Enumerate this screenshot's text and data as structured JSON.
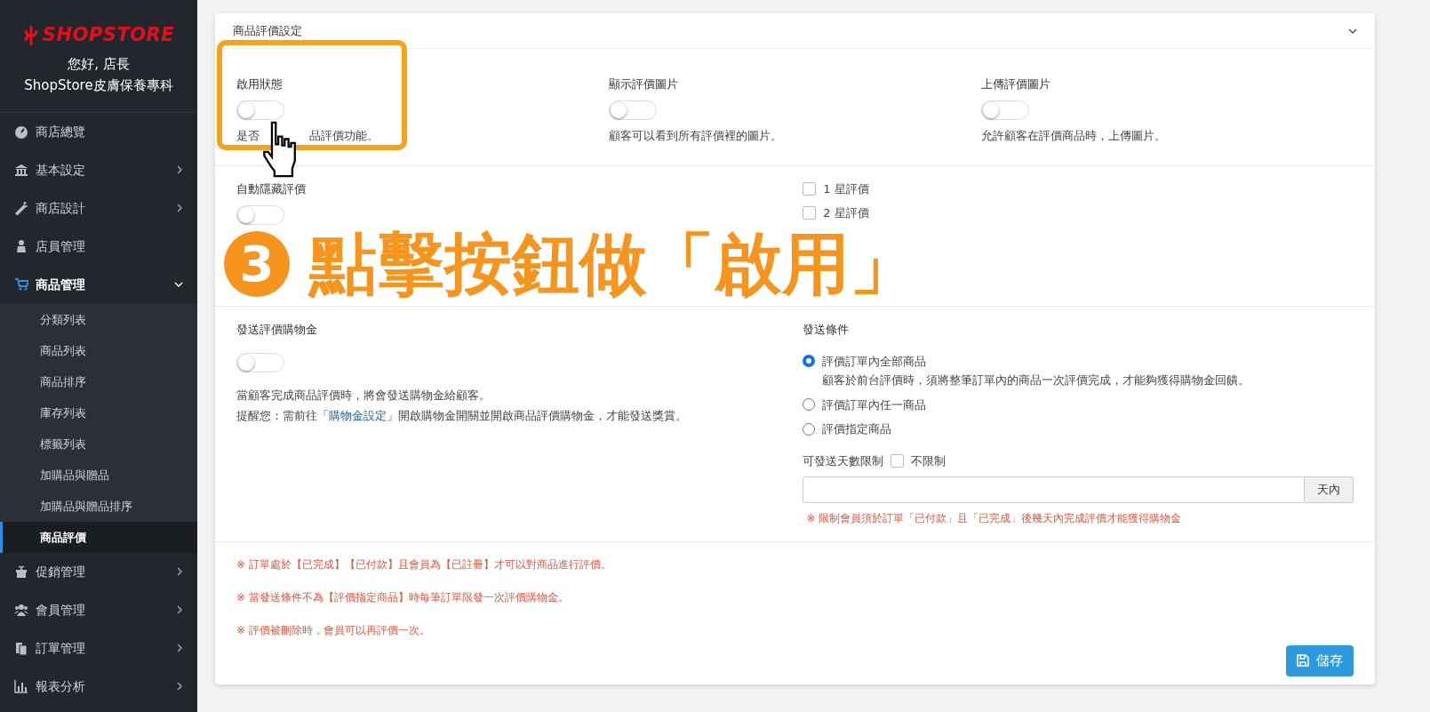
{
  "sidebar": {
    "logo": "SHOPSTORE",
    "greeting": "您好, 店長",
    "store_name": "ShopStore皮膚保養專科",
    "items": [
      {
        "label": "商店總覽",
        "kind": "link",
        "expanded": false
      },
      {
        "label": "基本設定",
        "kind": "menu",
        "expanded": false
      },
      {
        "label": "商店設計",
        "kind": "menu",
        "expanded": false
      },
      {
        "label": "店員管理",
        "kind": "link",
        "expanded": false
      },
      {
        "label": "商品管理",
        "kind": "menu",
        "expanded": true,
        "children": [
          {
            "label": "分類列表",
            "selected": false
          },
          {
            "label": "商品列表",
            "selected": false
          },
          {
            "label": "商品排序",
            "selected": false
          },
          {
            "label": "庫存列表",
            "selected": false
          },
          {
            "label": "標籤列表",
            "selected": false
          },
          {
            "label": "加購品與贈品",
            "selected": false
          },
          {
            "label": "加購品與贈品排序",
            "selected": false
          },
          {
            "label": "商品評價",
            "selected": true
          }
        ]
      },
      {
        "label": "促銷管理",
        "kind": "menu",
        "expanded": false
      },
      {
        "label": "會員管理",
        "kind": "menu",
        "expanded": false
      },
      {
        "label": "訂單管理",
        "kind": "menu",
        "expanded": false
      },
      {
        "label": "報表分析",
        "kind": "menu",
        "expanded": false
      }
    ]
  },
  "panel": {
    "title": "商品評價設定",
    "toggles": [
      {
        "label": "啟用狀態",
        "on": false,
        "description_parts": [
          "是否",
          "品評價功能。"
        ]
      },
      {
        "label": "顯示評價圖片",
        "on": false,
        "description": "顧客可以看到所有評價裡的圖片。"
      },
      {
        "label": "上傳評價圖片",
        "on": false,
        "description": "允許顧客在評價商品時，上傳圖片。"
      }
    ],
    "auto_hide": {
      "label": "自動隱藏評價",
      "on": false,
      "stars": [
        {
          "label": "1 星評價",
          "checked": false
        },
        {
          "label": "2 星評價",
          "checked": false
        }
      ]
    },
    "reward": {
      "label": "發送評價購物金",
      "on": false,
      "description": "當顧客完成商品評價時，將會發送購物金給顧客。",
      "reminder_before": "提醒您：需前往「",
      "reminder_link": "購物金設定",
      "reminder_after": "」開啟購物金開關並開啟商品評價購物金，才能發送獎賞。"
    },
    "conditions": {
      "title": "發送條件",
      "options": [
        {
          "label": "評價訂單內全部商品",
          "selected": true,
          "note": "顧客於前台評價時，須將整筆訂單內的商品一次評價完成，才能夠獲得購物金回饋。"
        },
        {
          "label": "評價訂單內任一商品",
          "selected": false
        },
        {
          "label": "評價指定商品",
          "selected": false
        }
      ],
      "day_limit": {
        "label": "可發送天數限制",
        "unlimited_label": "不限制",
        "unlimited": false,
        "suffix": "天內",
        "warning": "※ 限制會員須於訂單「已付款」且「已完成」後幾天內完成評價才能獲得購物金"
      }
    },
    "notes": [
      "※ 訂單處於【已完成】【已付款】且會員為【已註冊】才可以對商品進行評價。",
      "※ 當發送條件不為【評價指定商品】時每筆訂單限發一次評價購物金。",
      "※ 評價被刪除時，會員可以再評價一次。"
    ],
    "save_button": "儲存"
  },
  "annotation": {
    "step": "3",
    "text": "點擊按鈕做「啟用」"
  }
}
